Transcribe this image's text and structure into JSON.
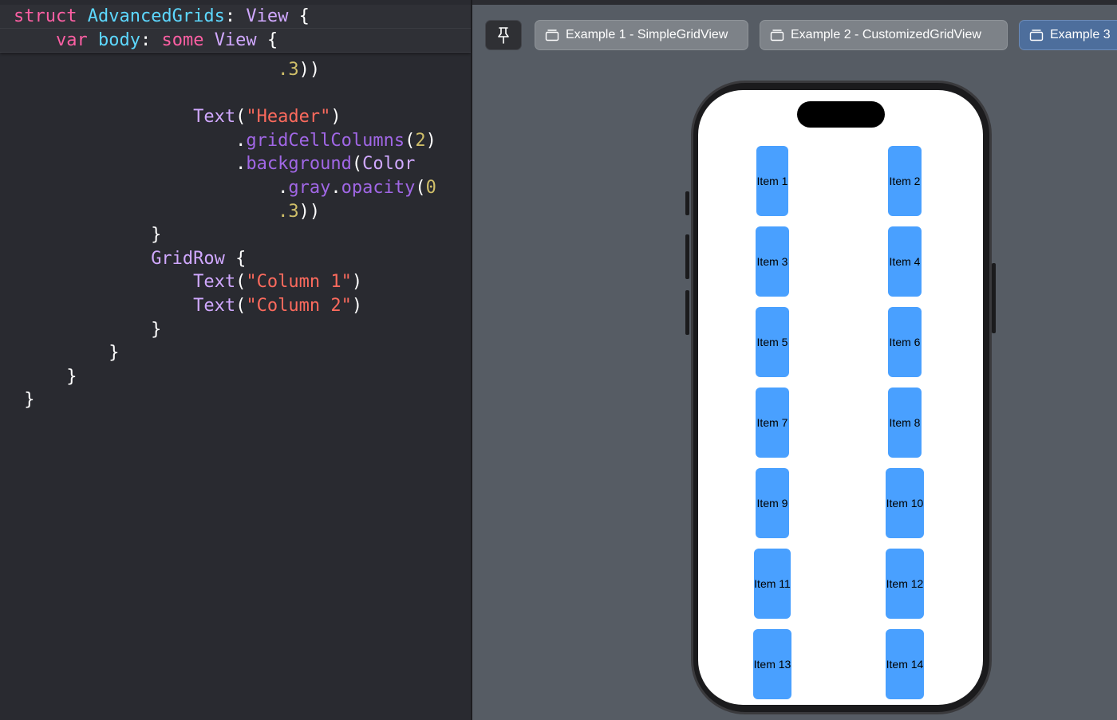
{
  "editor": {
    "sticky_lines": [
      [
        {
          "t": "struct ",
          "c": "kw"
        },
        {
          "t": "AdvancedGrids",
          "c": "type"
        },
        {
          "t": ": ",
          "c": "plain"
        },
        {
          "t": "View",
          "c": "vtype"
        },
        {
          "t": " {",
          "c": "plain"
        }
      ],
      [
        {
          "t": "    ",
          "c": "plain"
        },
        {
          "t": "var ",
          "c": "kw"
        },
        {
          "t": "body",
          "c": "type"
        },
        {
          "t": ": ",
          "c": "plain"
        },
        {
          "t": "some ",
          "c": "kw"
        },
        {
          "t": "View",
          "c": "vtype"
        },
        {
          "t": " {",
          "c": "plain"
        }
      ]
    ],
    "lines": [
      [
        {
          "t": "                         ",
          "c": "plain"
        },
        {
          "t": ".3",
          "c": "num"
        },
        {
          "t": "))",
          "c": "plain"
        }
      ],
      [],
      [
        {
          "t": "                 ",
          "c": "plain"
        },
        {
          "t": "Text",
          "c": "vtype"
        },
        {
          "t": "(",
          "c": "plain"
        },
        {
          "t": "\"Header\"",
          "c": "str"
        },
        {
          "t": ")",
          "c": "plain"
        }
      ],
      [
        {
          "t": "                     ",
          "c": "plain"
        },
        {
          "t": ".",
          "c": "plain"
        },
        {
          "t": "gridCellColumns",
          "c": "fn"
        },
        {
          "t": "(",
          "c": "plain"
        },
        {
          "t": "2",
          "c": "num"
        },
        {
          "t": ")",
          "c": "plain"
        }
      ],
      [
        {
          "t": "                     ",
          "c": "plain"
        },
        {
          "t": ".",
          "c": "plain"
        },
        {
          "t": "background",
          "c": "fn"
        },
        {
          "t": "(",
          "c": "plain"
        },
        {
          "t": "Color",
          "c": "vtype"
        }
      ],
      [
        {
          "t": "                         ",
          "c": "plain"
        },
        {
          "t": ".",
          "c": "plain"
        },
        {
          "t": "gray",
          "c": "fn"
        },
        {
          "t": ".",
          "c": "plain"
        },
        {
          "t": "opacity",
          "c": "fn"
        },
        {
          "t": "(",
          "c": "plain"
        },
        {
          "t": "0",
          "c": "num"
        }
      ],
      [
        {
          "t": "                         ",
          "c": "plain"
        },
        {
          "t": ".3",
          "c": "num"
        },
        {
          "t": "))",
          "c": "plain"
        }
      ],
      [
        {
          "t": "             }",
          "c": "plain"
        }
      ],
      [
        {
          "t": "             ",
          "c": "plain"
        },
        {
          "t": "GridRow",
          "c": "vtype"
        },
        {
          "t": " {",
          "c": "plain"
        }
      ],
      [
        {
          "t": "                 ",
          "c": "plain"
        },
        {
          "t": "Text",
          "c": "vtype"
        },
        {
          "t": "(",
          "c": "plain"
        },
        {
          "t": "\"Column 1\"",
          "c": "str"
        },
        {
          "t": ")",
          "c": "plain"
        }
      ],
      [
        {
          "t": "                 ",
          "c": "plain"
        },
        {
          "t": "Text",
          "c": "vtype"
        },
        {
          "t": "(",
          "c": "plain"
        },
        {
          "t": "\"Column 2\"",
          "c": "str"
        },
        {
          "t": ")",
          "c": "plain"
        }
      ],
      [
        {
          "t": "             }",
          "c": "plain"
        }
      ],
      [
        {
          "t": "         }",
          "c": "plain"
        }
      ],
      [
        {
          "t": "     }",
          "c": "plain"
        }
      ],
      [
        {
          "t": " }",
          "c": "plain"
        }
      ]
    ]
  },
  "canvas": {
    "pin_icon": "pin-icon",
    "tabs": [
      {
        "label": "Example 1 - SimpleGridView",
        "icon": "preview-icon",
        "active": false
      },
      {
        "label": "Example 2 - CustomizedGridView",
        "icon": "preview-icon",
        "active": false
      },
      {
        "label": "Example 3",
        "icon": "preview-icon",
        "active": true
      }
    ]
  },
  "preview": {
    "item_color": "#49a0ff",
    "items": [
      "Item 1",
      "Item 2",
      "Item 3",
      "Item 4",
      "Item 5",
      "Item 6",
      "Item 7",
      "Item 8",
      "Item 9",
      "Item 10",
      "Item 11",
      "Item 12",
      "Item 13",
      "Item 14"
    ]
  },
  "colors": {
    "keyword": "#fc5fa3",
    "type": "#5dd8ff",
    "view_type": "#d0a8ff",
    "string": "#fc6a5d",
    "number": "#d0bf69",
    "function": "#a167e6"
  }
}
